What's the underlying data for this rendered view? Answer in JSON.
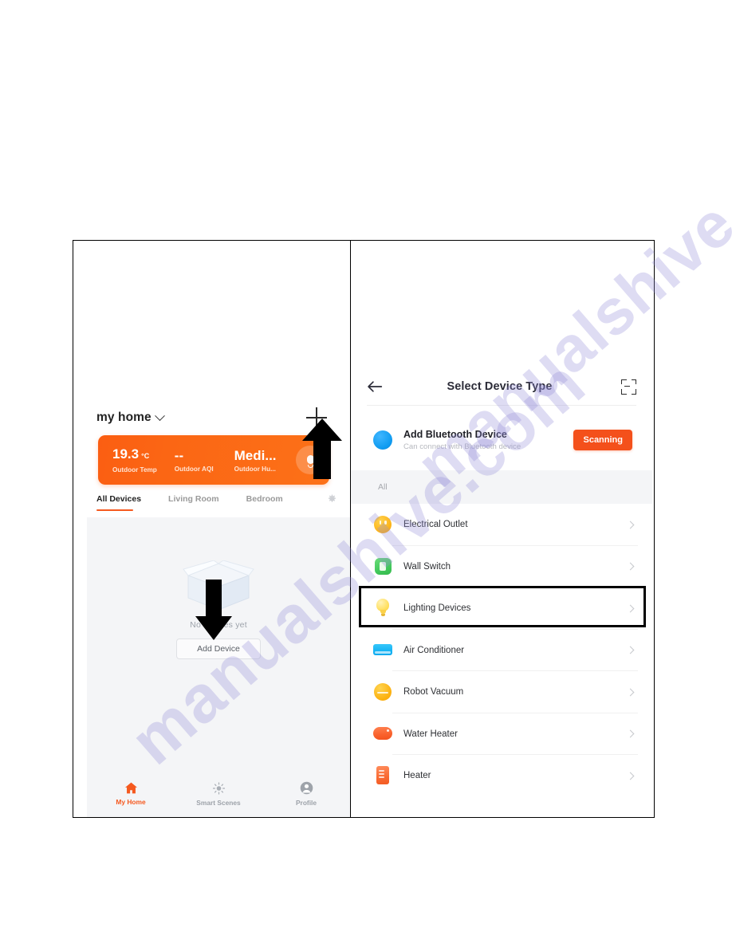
{
  "watermark": {
    "text": "manualshive.com"
  },
  "left_screen": {
    "header": {
      "home_name": "my home",
      "add_icon": "plus-icon",
      "dropdown_icon": "chevron-down-icon"
    },
    "weather_card": {
      "stats": [
        {
          "value": "19.3",
          "unit": "°C",
          "label": "Outdoor Temp"
        },
        {
          "value": "--",
          "unit": "",
          "label": "Outdoor AQI"
        },
        {
          "value": "Medi...",
          "unit": "",
          "label": "Outdoor Hu..."
        }
      ],
      "mic_icon": "microphone-icon"
    },
    "tabs": [
      {
        "label": "All Devices",
        "active": true
      },
      {
        "label": "Living Room",
        "active": false
      },
      {
        "label": "Bedroom",
        "active": false
      }
    ],
    "tabs_settings_icon": "gear-icon",
    "empty_state": {
      "illustration": "open-box-icon",
      "message": "No devices yet",
      "button_label": "Add Device"
    },
    "bottom_nav": [
      {
        "label": "My Home",
        "icon": "home-icon",
        "active": true
      },
      {
        "label": "Smart Scenes",
        "icon": "sun-icon",
        "active": false
      },
      {
        "label": "Profile",
        "icon": "person-icon",
        "active": false
      }
    ]
  },
  "right_screen": {
    "header": {
      "back_icon": "back-arrow-icon",
      "title": "Select Device Type",
      "scan_icon": "scan-qr-icon"
    },
    "bluetooth": {
      "icon": "bluetooth-icon",
      "title": "Add Bluetooth Device",
      "subtitle": "Can connect with Bluetooth device",
      "action_label": "Scanning"
    },
    "filter": {
      "selected": "All"
    },
    "devices": [
      {
        "name": "Electrical Outlet",
        "icon": "outlet-icon",
        "highlighted": false
      },
      {
        "name": "Wall Switch",
        "icon": "wall-switch-icon",
        "highlighted": false
      },
      {
        "name": "Lighting Devices",
        "icon": "light-bulb-icon",
        "highlighted": true
      },
      {
        "name": "Air Conditioner",
        "icon": "air-conditioner-icon",
        "highlighted": false
      },
      {
        "name": "Robot Vacuum",
        "icon": "robot-vacuum-icon",
        "highlighted": false
      },
      {
        "name": "Water Heater",
        "icon": "water-heater-icon",
        "highlighted": false
      },
      {
        "name": "Heater",
        "icon": "heater-icon",
        "highlighted": false
      }
    ],
    "chevron_icon": "chevron-right-icon"
  },
  "annotations": [
    {
      "name": "arrow-pointing-to-add-button",
      "direction": "up"
    },
    {
      "name": "arrow-pointing-to-add-device-button",
      "direction": "down"
    }
  ],
  "colors": {
    "brand_orange": "#f5591f",
    "card_orange": "#fb6614",
    "scanning_orange": "#f4501b",
    "bluetooth_blue": "#109cf1",
    "watermark": "#918cd7"
  }
}
